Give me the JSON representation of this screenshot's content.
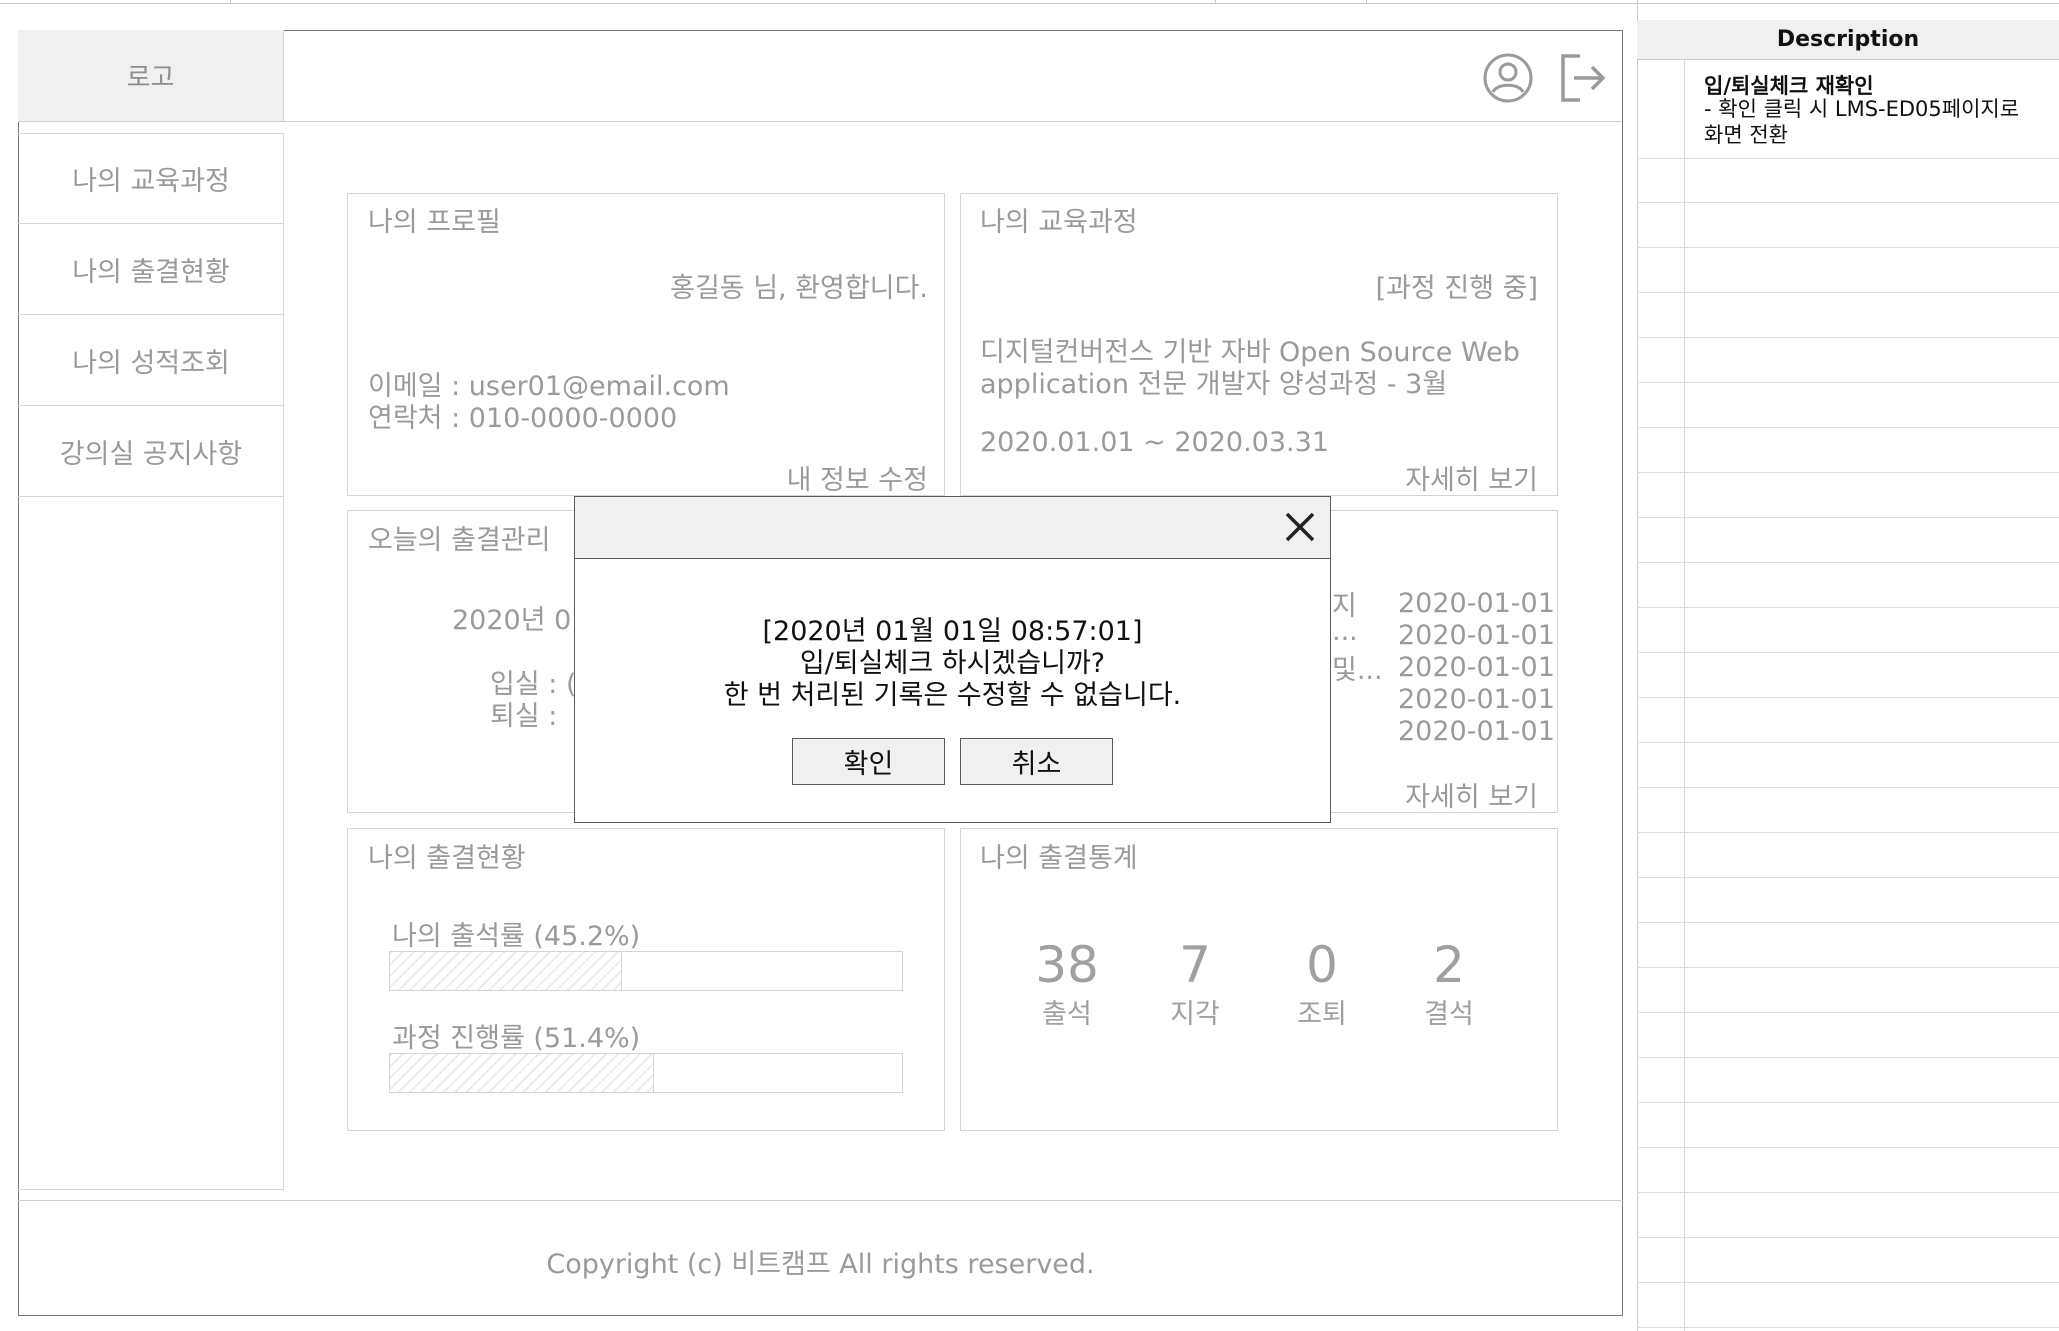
{
  "header": {
    "logo": "로고"
  },
  "sidebar": {
    "items": [
      {
        "label": "나의 교육과정"
      },
      {
        "label": "나의 출결현황"
      },
      {
        "label": "나의 성적조회"
      },
      {
        "label": "강의실 공지사항"
      }
    ]
  },
  "profile": {
    "title": "나의 프로필",
    "welcome": "홍길동 님, 환영합니다.",
    "email": "이메일 : user01@email.com",
    "phone": "연락처 : 010-0000-0000",
    "edit": "내 정보 수정"
  },
  "course": {
    "title": "나의 교육과정",
    "status": "[과정 진행 중]",
    "name_line1": "디지털컨버전스 기반 자바 Open Source Web",
    "name_line2": "application 전문 개발자 양성과정 - 3월",
    "period": "2020.01.01 ~ 2020.03.31",
    "detail": "자세히 보기"
  },
  "attendance_today": {
    "title": "오늘의 출결관리",
    "date_partial": "2020년 01",
    "checkin_partial": "입실 : (",
    "checkout_partial": "퇴실 :"
  },
  "notices": {
    "fragments": [
      "지",
      "...",
      "및..."
    ],
    "dates": [
      "2020-01-01",
      "2020-01-01",
      "2020-01-01",
      "2020-01-01",
      "2020-01-01"
    ],
    "detail": "자세히 보기"
  },
  "attendance_status": {
    "title": "나의 출결현황",
    "attendance_rate_label": "나의 출석률 (45.2%)",
    "attendance_rate": 0.452,
    "progress_rate_label": "과정 진행률 (51.4%)",
    "progress_rate": 0.514
  },
  "attendance_stats": {
    "title": "나의 출결통계",
    "items": [
      {
        "value": "38",
        "label": "출석"
      },
      {
        "value": "7",
        "label": "지각"
      },
      {
        "value": "0",
        "label": "조퇴"
      },
      {
        "value": "2",
        "label": "결석"
      }
    ]
  },
  "footer": {
    "copyright": "Copyright (c) 비트캠프 All rights reserved."
  },
  "dialog": {
    "timestamp": "[2020년 01월 01일 08:57:01]",
    "question": "입/퇴실체크 하시겠습니까?",
    "warning": "한 번 처리된 기록은 수정할 수 없습니다.",
    "confirm": "확인",
    "cancel": "취소"
  },
  "description": {
    "header": "Description",
    "title": "입/퇴실체크 재확인",
    "body_line1": "- 확인 클릭 시 LMS-ED05페이지로",
    "body_line2": "화면 전환"
  },
  "colors": {
    "wire": "#9a9a9a",
    "border": "#d4d4d4",
    "dialog_border": "#5a5a5a",
    "panel_fill": "#f0f0f0"
  },
  "icons": {
    "user": "user-circle-icon",
    "logout": "logout-icon",
    "close": "close-icon"
  }
}
